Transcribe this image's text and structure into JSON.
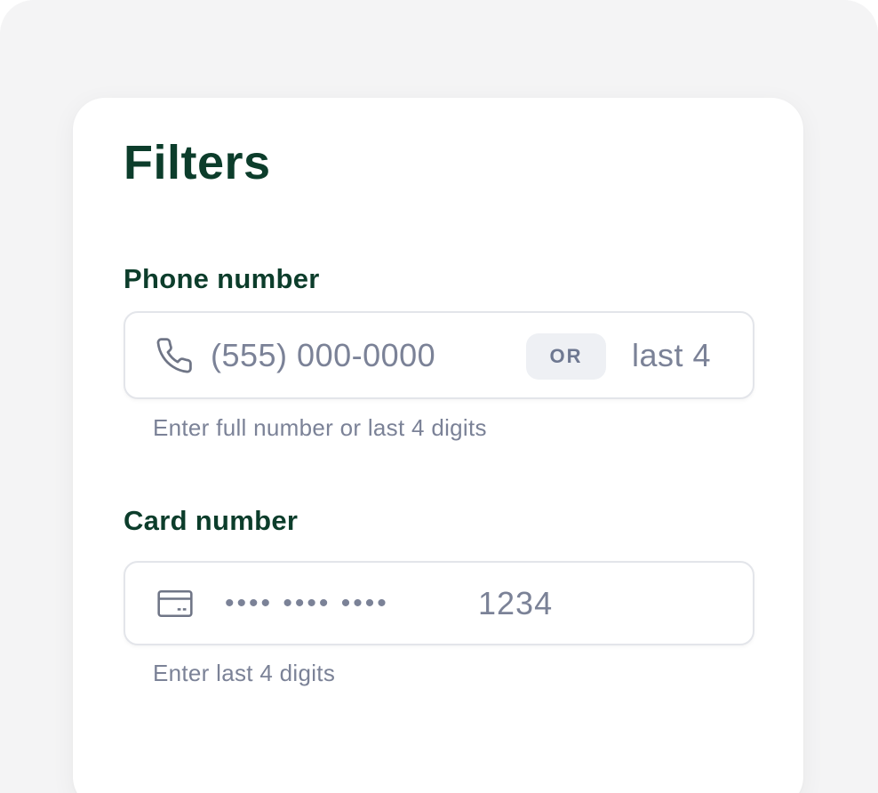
{
  "filters": {
    "title": "Filters",
    "phone": {
      "label": "Phone number",
      "icon": "phone-icon",
      "placeholder": "(555) 000-0000",
      "separator": "OR",
      "alt_placeholder": "last 4",
      "hint": "Enter full number or last 4 digits"
    },
    "card": {
      "label": "Card number",
      "icon": "credit-card-icon",
      "masked": "•••• •••• ••••",
      "placeholder": "1234",
      "hint": "Enter last 4 digits"
    }
  },
  "colors": {
    "heading": "#0c3d2b",
    "muted_text": "#7b8297",
    "pill_background": "#eef0f4",
    "input_border": "#e3e5ea",
    "page_background": "#f4f4f5"
  }
}
